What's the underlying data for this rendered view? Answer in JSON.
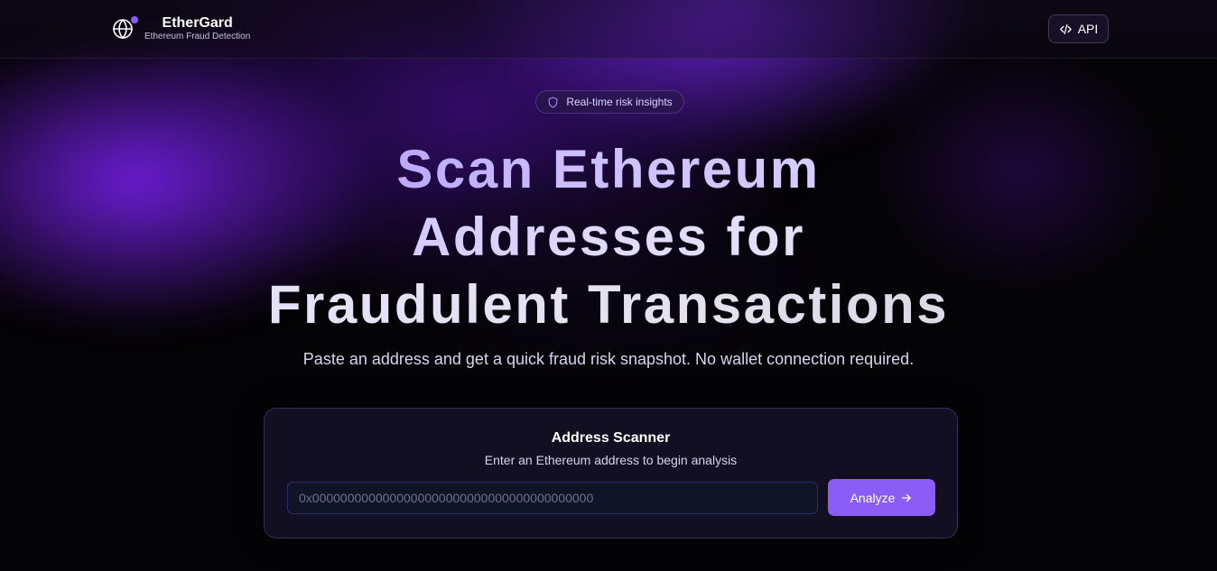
{
  "header": {
    "brand_title": "EtherGard",
    "brand_subtitle": "Ethereum Fraud Detection",
    "brand_icon": "globe-icon",
    "api_label": "API",
    "api_icon": "code-icon"
  },
  "hero": {
    "badge_label": "Real-time risk insights",
    "badge_icon": "shield-icon",
    "headline_line1": "Scan Ethereum",
    "headline_line2": "Addresses for",
    "headline_line3": "Fraudulent Transactions",
    "subheadline": "Paste an address and get a quick fraud risk snapshot. No wallet connection required."
  },
  "scanner": {
    "title": "Address Scanner",
    "subtitle": "Enter an Ethereum address to begin analysis",
    "input_value": "",
    "input_placeholder": "0x0000000000000000000000000000000000000000",
    "analyze_label": "Analyze",
    "analyze_icon": "arrow-right-icon"
  },
  "colors": {
    "accent": "#8b5cf6",
    "background": "#040305",
    "card_background": "#121024"
  }
}
